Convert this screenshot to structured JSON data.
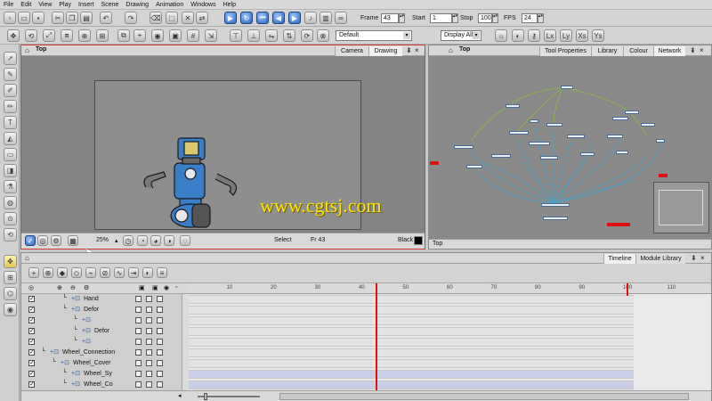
{
  "menu": [
    "File",
    "Edit",
    "View",
    "Play",
    "Insert",
    "Scene",
    "Drawing",
    "Animation",
    "Windows",
    "Help"
  ],
  "playback": {
    "frame_label": "Frame",
    "frame_value": "43",
    "start_label": "Start",
    "start_value": "1",
    "stop_label": "Stop",
    "stop_value": "100",
    "fps_label": "FPS",
    "fps_value": "24"
  },
  "toolbar2": {
    "palette_select": "Default",
    "display_select": "Display All"
  },
  "camera_view": {
    "title": "Top",
    "tabs": [
      "Camera",
      "Drawing"
    ],
    "zoom": "25%",
    "tool_status": "Select",
    "frame_status": "Fr 43",
    "color_label": "Black"
  },
  "network_view": {
    "title": "Top",
    "tabs": [
      "Tool Properties",
      "Library",
      "Colour",
      "Network"
    ],
    "footer_label": "Top"
  },
  "watermark": "www.cgtsj.com",
  "timeline": {
    "tabs": [
      "Timeline",
      "Module Library"
    ],
    "ruler_ticks": [
      "10",
      "20",
      "30",
      "40",
      "50",
      "60",
      "70",
      "80",
      "90",
      "100",
      "110"
    ],
    "current_frame": 43,
    "layers": [
      {
        "name": "Hand",
        "depth": 3
      },
      {
        "name": "Defor",
        "depth": 3
      },
      {
        "name": "",
        "depth": 4
      },
      {
        "name": "Defor",
        "depth": 4
      },
      {
        "name": "",
        "depth": 4
      },
      {
        "name": "Wheel_Connection",
        "depth": 1
      },
      {
        "name": "Wheel_Cover",
        "depth": 2
      },
      {
        "name": "Wheel_Sy",
        "depth": 3
      },
      {
        "name": "Wheel_Co",
        "depth": 3
      }
    ]
  },
  "colors": {
    "accent_red": "#e01010",
    "network_line": "#3aa8d8",
    "network_green": "#8fbd3a",
    "robot_blue": "#3a7ec8"
  }
}
